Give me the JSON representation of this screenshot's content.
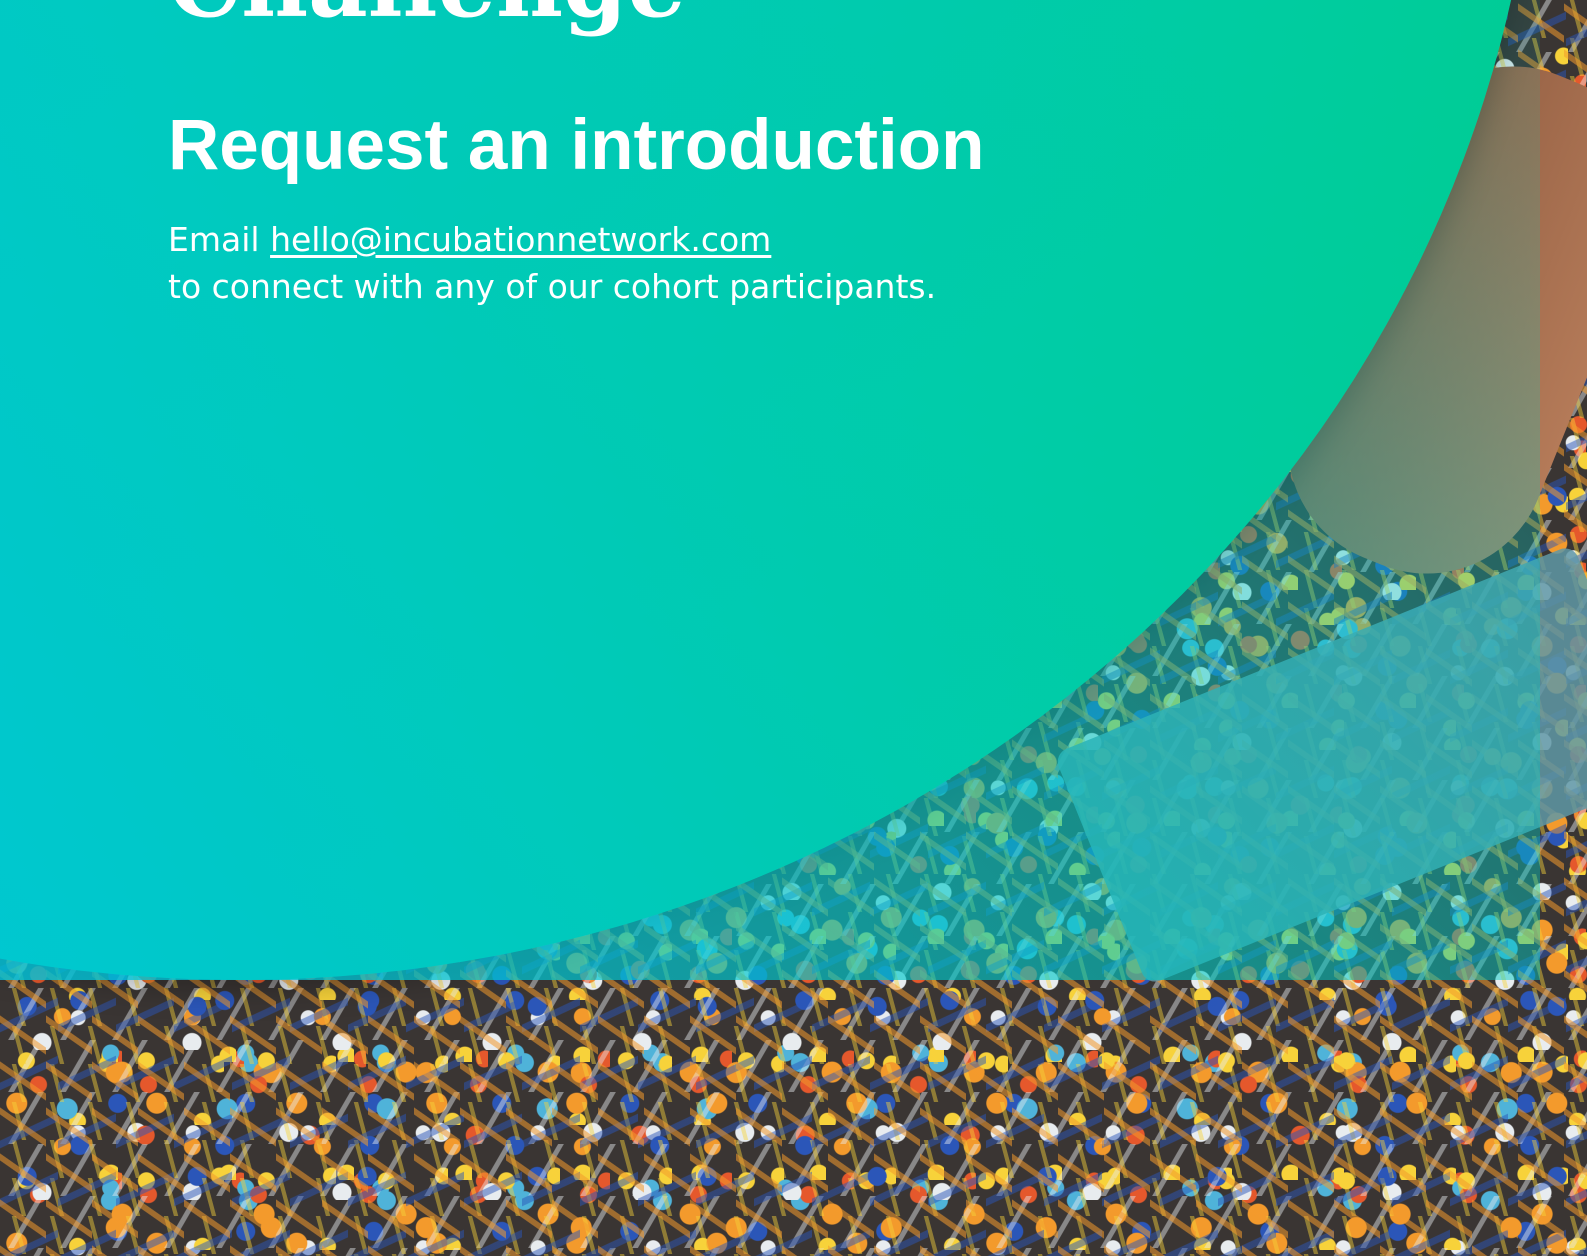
{
  "hero": {
    "cut_title": "Challenge",
    "headline": "Request an introduction",
    "email_prefix": "Email",
    "email_address": "hello@incubationnetwork.com",
    "email_suffix": "to connect with any of our cohort participants."
  },
  "colors": {
    "gradient_start": "#00c2ec",
    "gradient_end": "#00cf6e",
    "text": "#ffffff"
  },
  "background": {
    "image_subject": "shredded-plastic-photo"
  }
}
